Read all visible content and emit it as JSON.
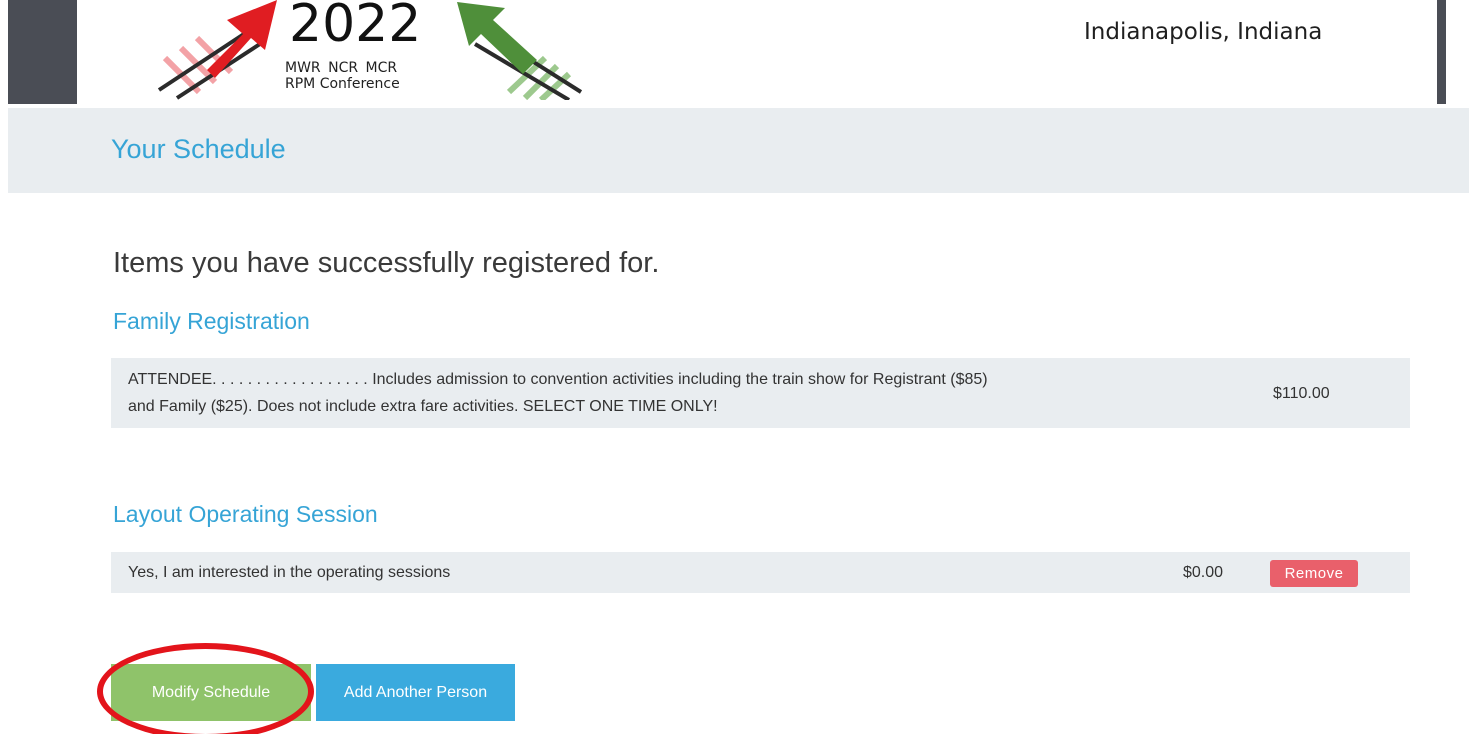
{
  "header": {
    "logo_year": "2022",
    "logo_orgs": "MWR NCR MCR",
    "logo_event": "RPM Conference",
    "location": "Indianapolis, Indiana"
  },
  "page": {
    "title": "Your Schedule",
    "intro": "Items you have successfully registered for."
  },
  "sections": [
    {
      "title": "Family Registration",
      "items": [
        {
          "description_line1": "ATTENDEE. . . . . . . . . . . . . . . . . . Includes admission to convention activities including the train show for Registrant ($85)",
          "description_line2": "and Family ($25). Does not include extra fare activities. SELECT ONE TIME ONLY!",
          "price": "$110.00"
        }
      ]
    },
    {
      "title": "Layout Operating Session",
      "items": [
        {
          "description": "Yes, I am interested in the operating sessions",
          "price": "$0.00",
          "remove_label": "Remove"
        }
      ]
    }
  ],
  "actions": {
    "modify_label": "Modify Schedule",
    "add_person_label": "Add Another Person"
  },
  "colors": {
    "accent_blue": "#36a4d6",
    "button_green": "#8fc36a",
    "button_blue": "#3aaade",
    "remove_red": "#e9606b",
    "highlight_red": "#e3141b",
    "panel_gray": "#e9edf0"
  },
  "icons": {
    "logo_left": "red-arrow-track-icon",
    "logo_right": "green-arrow-track-icon"
  }
}
